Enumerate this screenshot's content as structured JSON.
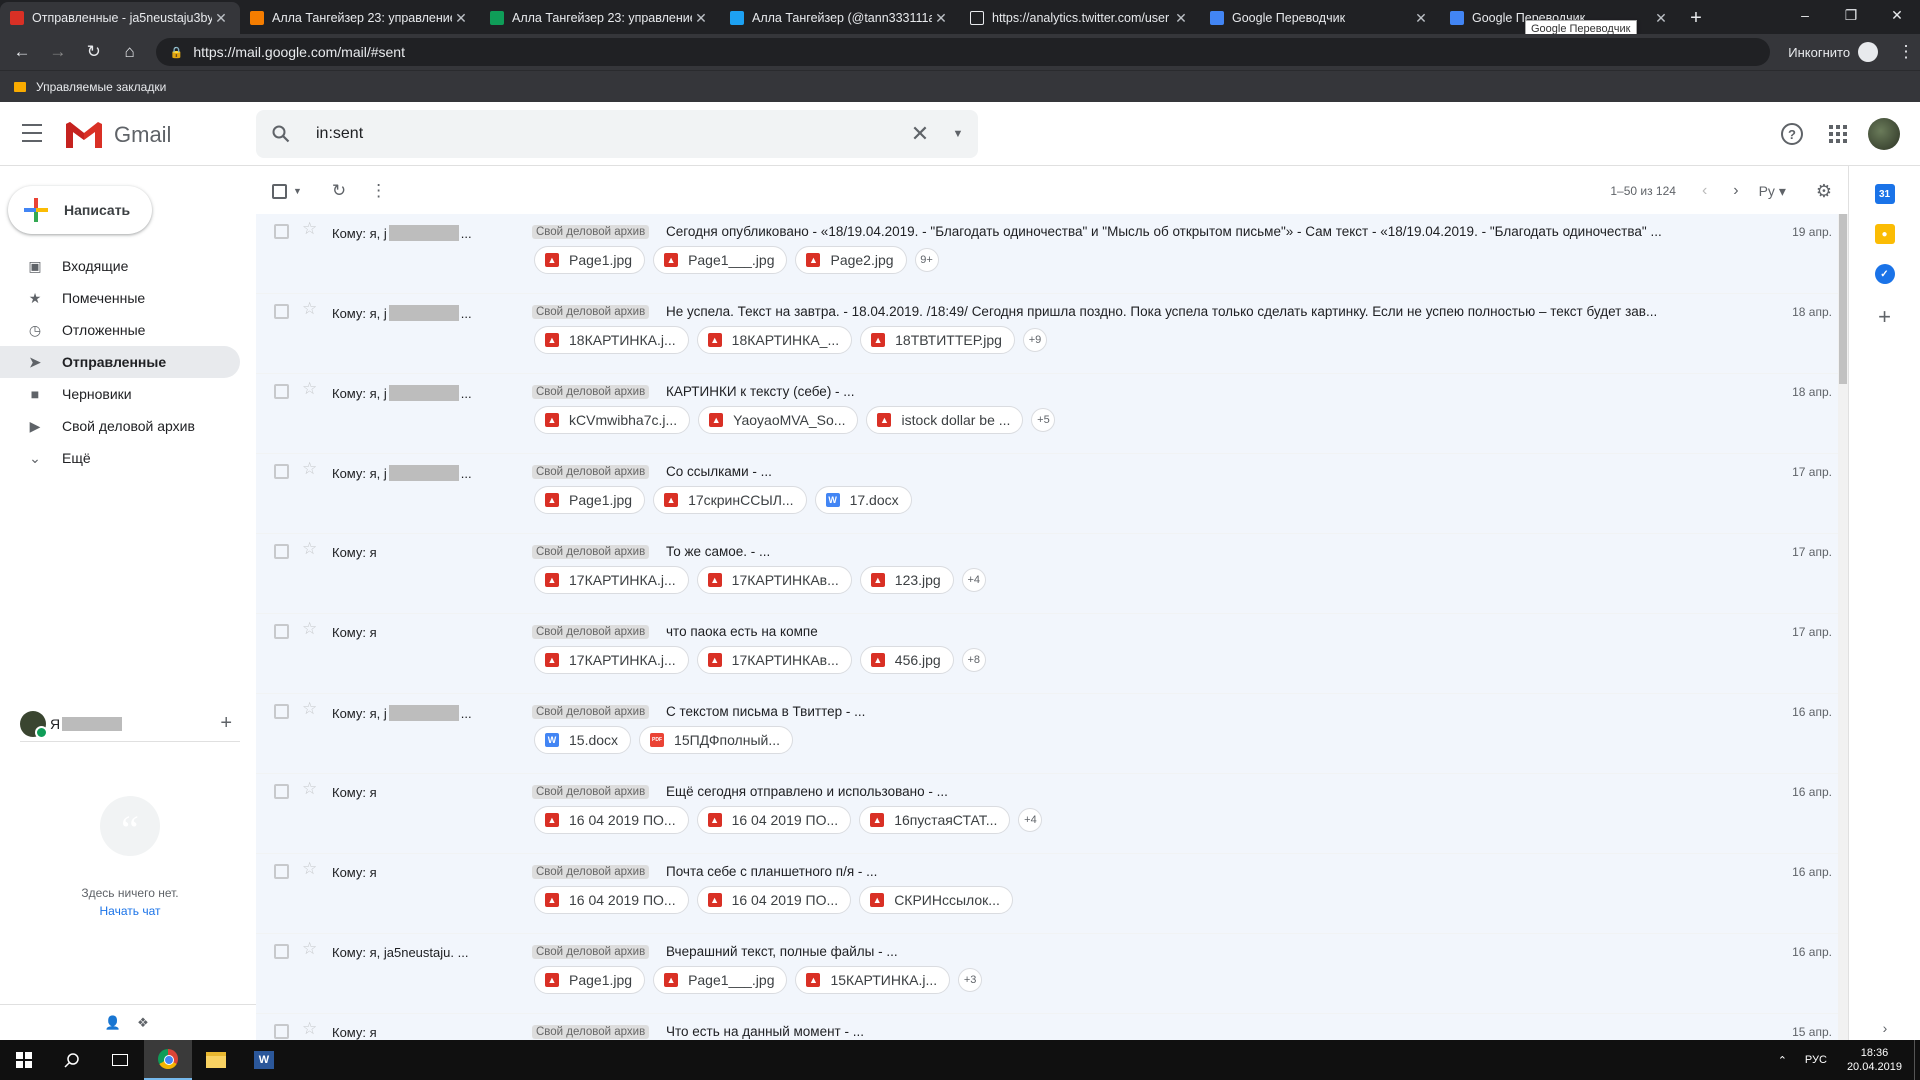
{
  "browser": {
    "tabs": [
      {
        "title": "Отправленные - ja5neustaju3by",
        "favicon": "gmail-icon",
        "active": true
      },
      {
        "title": "Алла Тангейзер 23: управление",
        "favicon": "blogger-icon"
      },
      {
        "title": "Алла Тангейзер 23: управление",
        "favicon": "sheet-icon"
      },
      {
        "title": "Алла Тангейзер (@tann333111a",
        "favicon": "twitter-icon"
      },
      {
        "title": "https://analytics.twitter.com/user",
        "favicon": "page-icon"
      },
      {
        "title": "Google Переводчик",
        "favicon": "translate-icon"
      },
      {
        "title": "Google Переводчик",
        "favicon": "translate-icon"
      }
    ],
    "tooltip": "Google Переводчик",
    "url": "https://mail.google.com/mail/#sent",
    "incognito": "Инкогнито",
    "bookmarks_folder": "Управляемые закладки"
  },
  "gmail": {
    "product": "Gmail",
    "search_value": "in:sent",
    "compose": "Написать",
    "nav": [
      {
        "label": "Входящие",
        "icon": "inbox-icon"
      },
      {
        "label": "Помеченные",
        "icon": "star-icon"
      },
      {
        "label": "Отложенные",
        "icon": "clock-icon"
      },
      {
        "label": "Отправленные",
        "icon": "send-icon",
        "active": true
      },
      {
        "label": "Черновики",
        "icon": "draft-icon"
      },
      {
        "label": "Свой деловой архив",
        "icon": "label-icon"
      },
      {
        "label": "Ещё",
        "icon": "chevron-down-icon"
      }
    ],
    "hangouts": {
      "user_initial": "Я",
      "empty_text": "Здесь ничего нет.",
      "start_chat": "Начать чат"
    },
    "pager": {
      "range": "1–50 из 124",
      "lang": "Ру"
    },
    "label_name": "Свой деловой архив",
    "emails": [
      {
        "to": "Кому: я, j",
        "to_redacted": true,
        "subject": "Сегодня опубликовано - «18/19.04.2019. - \"Благодать одиночества\" и \"Мысль об открытом письме\"» - Сам текст - «18/19.04.2019. - \"Благодать одиночества\" ...",
        "date": "19 апр.",
        "attachments": [
          {
            "name": "Page1.jpg",
            "type": "img"
          },
          {
            "name": "Page1___.jpg",
            "type": "img"
          },
          {
            "name": "Page2.jpg",
            "type": "img"
          }
        ],
        "more": "9+"
      },
      {
        "to": "Кому: я, j",
        "to_redacted": true,
        "subject": "Не успела. Текст на завтра. - 18.04.2019. /18:49/ Сегодня пришла поздно. Пока успела только сделать картинку. Если не успею полностью – текст будет зав...",
        "date": "18 апр.",
        "attachments": [
          {
            "name": "18КАРТИНКА.j...",
            "type": "img"
          },
          {
            "name": "18КАРТИНКА_...",
            "type": "img"
          },
          {
            "name": "18ТВТИТТЕР.jpg",
            "type": "img"
          }
        ],
        "more": "+9"
      },
      {
        "to": "Кому: я, j",
        "to_redacted": true,
        "subject": "КАРТИНКИ к тексту (себе) - ...",
        "date": "18 апр.",
        "attachments": [
          {
            "name": "kCVmwibha7c.j...",
            "type": "img"
          },
          {
            "name": "YaoyaoMVA_So...",
            "type": "img"
          },
          {
            "name": "istock dollar be ...",
            "type": "img"
          }
        ],
        "more": "+5"
      },
      {
        "to": "Кому: я, j",
        "to_redacted": true,
        "subject": "Со ссылками - ...",
        "date": "17 апр.",
        "attachments": [
          {
            "name": "Page1.jpg",
            "type": "img"
          },
          {
            "name": "17скринССЫЛ...",
            "type": "img"
          },
          {
            "name": "17.docx",
            "type": "doc"
          }
        ],
        "more": ""
      },
      {
        "to": "Кому: я",
        "to_redacted": false,
        "subject": "То же самое. - ...",
        "date": "17 апр.",
        "attachments": [
          {
            "name": "17КАРТИНКА.j...",
            "type": "img"
          },
          {
            "name": "17КАРТИНКАв...",
            "type": "img"
          },
          {
            "name": "123.jpg",
            "type": "img"
          }
        ],
        "more": "+4"
      },
      {
        "to": "Кому: я",
        "to_redacted": false,
        "subject": "что паока есть на компе",
        "date": "17 апр.",
        "attachments": [
          {
            "name": "17КАРТИНКА.j...",
            "type": "img"
          },
          {
            "name": "17КАРТИНКАв...",
            "type": "img"
          },
          {
            "name": "456.jpg",
            "type": "img"
          }
        ],
        "more": "+8"
      },
      {
        "to": "Кому: я, j",
        "to_redacted": true,
        "subject": "С текстом письма в Твиттер - ...",
        "date": "16 апр.",
        "attachments": [
          {
            "name": "15.docx",
            "type": "doc"
          },
          {
            "name": "15ПДФполный...",
            "type": "pdf"
          }
        ],
        "more": ""
      },
      {
        "to": "Кому: я",
        "to_redacted": false,
        "subject": "Ещё сегодня отправлено и использовано - ...",
        "date": "16 апр.",
        "attachments": [
          {
            "name": "16 04 2019 ПО...",
            "type": "img"
          },
          {
            "name": "16 04 2019 ПО...",
            "type": "img"
          },
          {
            "name": "16пустаяСТАТ...",
            "type": "img"
          }
        ],
        "more": "+4"
      },
      {
        "to": "Кому: я",
        "to_redacted": false,
        "subject": "Почта себе с планшетного п/я - ...",
        "date": "16 апр.",
        "attachments": [
          {
            "name": "16 04 2019 ПО...",
            "type": "img"
          },
          {
            "name": "16 04 2019 ПО...",
            "type": "img"
          },
          {
            "name": "СКРИНссылок...",
            "type": "img"
          }
        ],
        "more": ""
      },
      {
        "to": "Кому: я, ja5neustaju. ...",
        "to_redacted": false,
        "subject": "Вчерашний текст, полные файлы - ...",
        "date": "16 апр.",
        "attachments": [
          {
            "name": "Page1.jpg",
            "type": "img"
          },
          {
            "name": "Page1___.jpg",
            "type": "img"
          },
          {
            "name": "15КАРТИНКА.j...",
            "type": "img"
          }
        ],
        "more": "+3"
      },
      {
        "to": "Кому: я",
        "to_redacted": false,
        "subject": "Что есть на данный момент - ...",
        "date": "15 апр.",
        "attachments": [],
        "more": ""
      }
    ]
  },
  "taskbar": {
    "lang": "РУС",
    "time": "18:36",
    "date": "20.04.2019"
  },
  "colors": {
    "accent": "#1a73e8",
    "gmail_red": "#d93025",
    "chrome_dark": "#202124"
  }
}
